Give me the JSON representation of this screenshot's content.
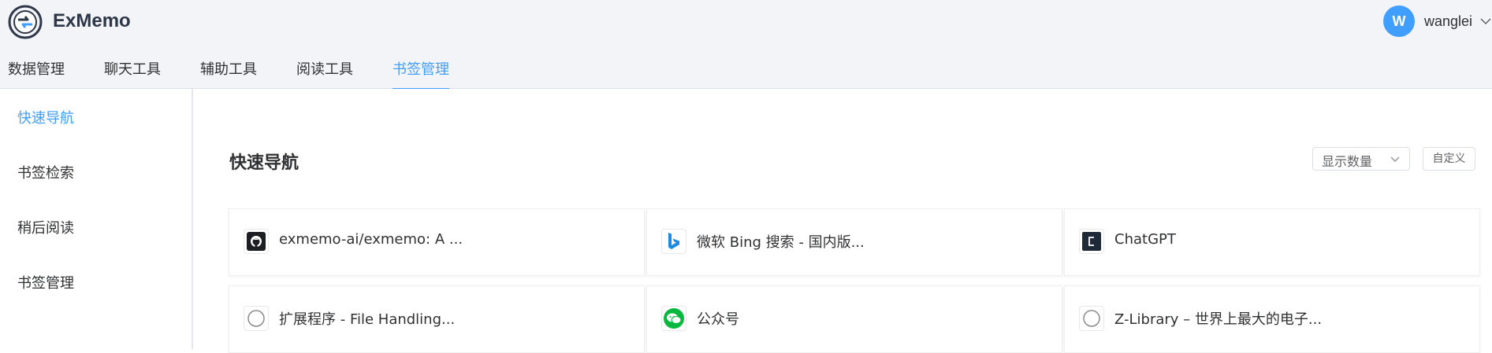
{
  "app": {
    "title": "ExMemo"
  },
  "user": {
    "avatar_letter": "W",
    "name": "wanglei"
  },
  "tabs": [
    {
      "label": "数据管理",
      "active": false
    },
    {
      "label": "聊天工具",
      "active": false
    },
    {
      "label": "辅助工具",
      "active": false
    },
    {
      "label": "阅读工具",
      "active": false
    },
    {
      "label": "书签管理",
      "active": true
    }
  ],
  "sidebar": {
    "items": [
      {
        "label": "快速导航",
        "active": true
      },
      {
        "label": "书签检索",
        "active": false
      },
      {
        "label": "稍后阅读",
        "active": false
      },
      {
        "label": "书签管理",
        "active": false
      }
    ]
  },
  "main": {
    "title": "快速导航",
    "count_select": "显示数量",
    "custom_button": "自定义",
    "cards": [
      {
        "label": "exmemo-ai/exmemo: A ...",
        "icon": "github-icon"
      },
      {
        "label": "微软 Bing 搜索 - 国内版...",
        "icon": "bing-icon"
      },
      {
        "label": "ChatGPT",
        "icon": "chatgpt-icon"
      },
      {
        "label": "扩展程序 - File Handling...",
        "icon": "default-globe-icon"
      },
      {
        "label": "公众号",
        "icon": "wechat-icon"
      },
      {
        "label": "Z-Library – 世界上最大的电子...",
        "icon": "default-globe-icon"
      }
    ]
  },
  "colors": {
    "accent": "#409eff",
    "header_bg": "#f3f4f7",
    "text": "#303133"
  }
}
